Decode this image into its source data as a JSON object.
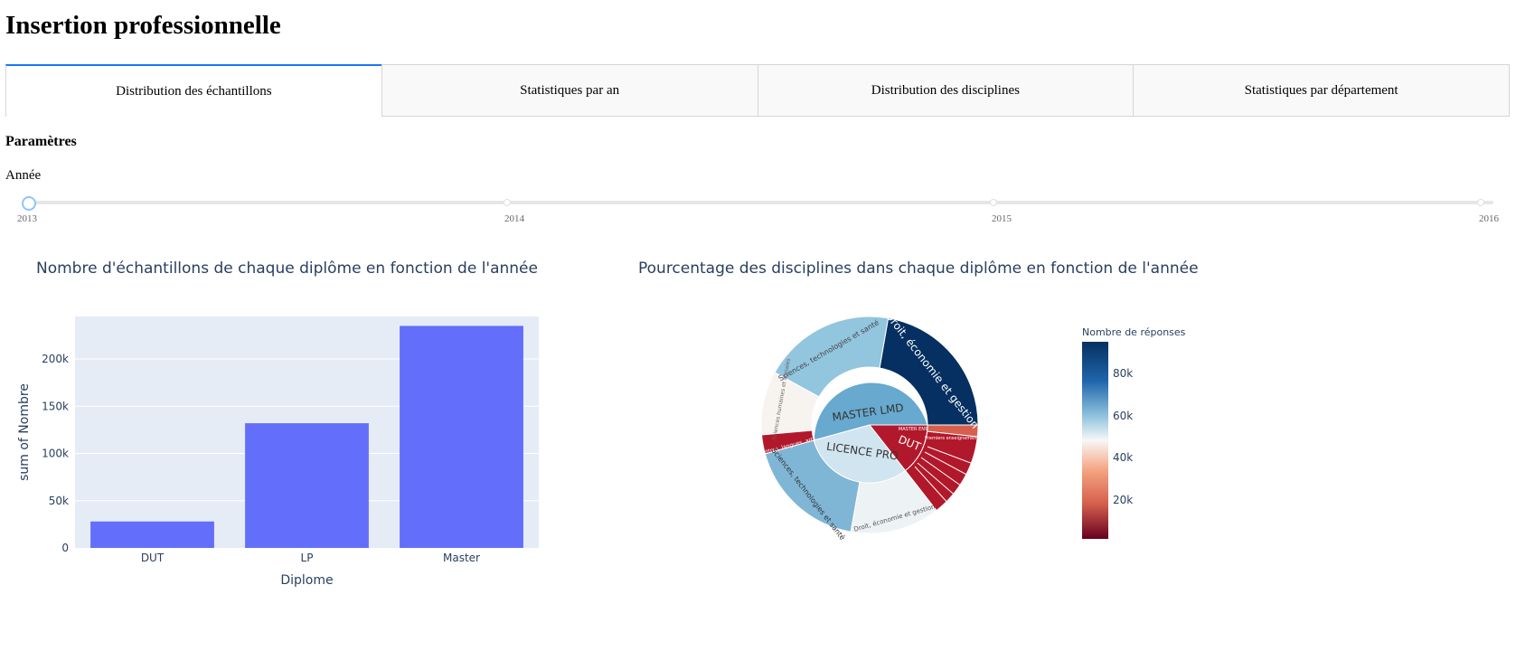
{
  "page": {
    "title": "Insertion professionnelle"
  },
  "tabs": [
    {
      "label": "Distribution des échantillons",
      "active": true
    },
    {
      "label": "Statistiques par an",
      "active": false
    },
    {
      "label": "Distribution des disciplines",
      "active": false
    },
    {
      "label": "Statistiques par département",
      "active": false
    }
  ],
  "params": {
    "title": "Paramètres",
    "year_label": "Année",
    "slider": {
      "marks": [
        "2013",
        "2014",
        "2015",
        "2016"
      ],
      "value": "2013"
    }
  },
  "bar_chart": {
    "title": "Nombre d'échantillons de chaque diplôme en fonction de l'année"
  },
  "sunburst": {
    "title": "Pourcentage des disciplines dans chaque diplôme en fonction de l'année",
    "colorbar_title": "Nombre de réponses",
    "colorbar_ticks": [
      "80k",
      "60k",
      "40k",
      "20k"
    ],
    "inner": [
      {
        "label": "MASTER LMD"
      },
      {
        "label": "LICENCE PRO"
      },
      {
        "label": "DUT"
      }
    ],
    "outer_labels": {
      "droit_master": "Droit, économie et gestion",
      "sciences_master": "Sciences, technologies et santé",
      "shs_master": "Sciences humaines et sociales",
      "lettres_master": "Lettres, langues, arts",
      "master_ens": "MASTER ENS",
      "ens_premier": "Premiers enseignements",
      "sciences_lp": "Sciences, technologies et santé",
      "droit_lp": "Droit, économie et gestion"
    },
    "colors": {
      "dark_blue": "#053061",
      "mid_blue": "#67a9cf",
      "light_blue": "#92c5de",
      "pale_blue": "#d1e5f0",
      "white": "#f7f7f7",
      "red": "#b2182b",
      "mid_red": "#d6604d"
    }
  },
  "chart_data": [
    {
      "type": "bar",
      "title": "Nombre d'échantillons de chaque diplôme en fonction de l'année",
      "categories": [
        "DUT",
        "LP",
        "Master"
      ],
      "values": [
        28000,
        132000,
        235000
      ],
      "xlabel": "Diplome",
      "ylabel": "sum of Nombre",
      "ylim": [
        0,
        245000
      ],
      "yticks": [
        "0",
        "50k",
        "100k",
        "150k",
        "200k"
      ],
      "color": "#636efa",
      "grid": true
    }
  ]
}
